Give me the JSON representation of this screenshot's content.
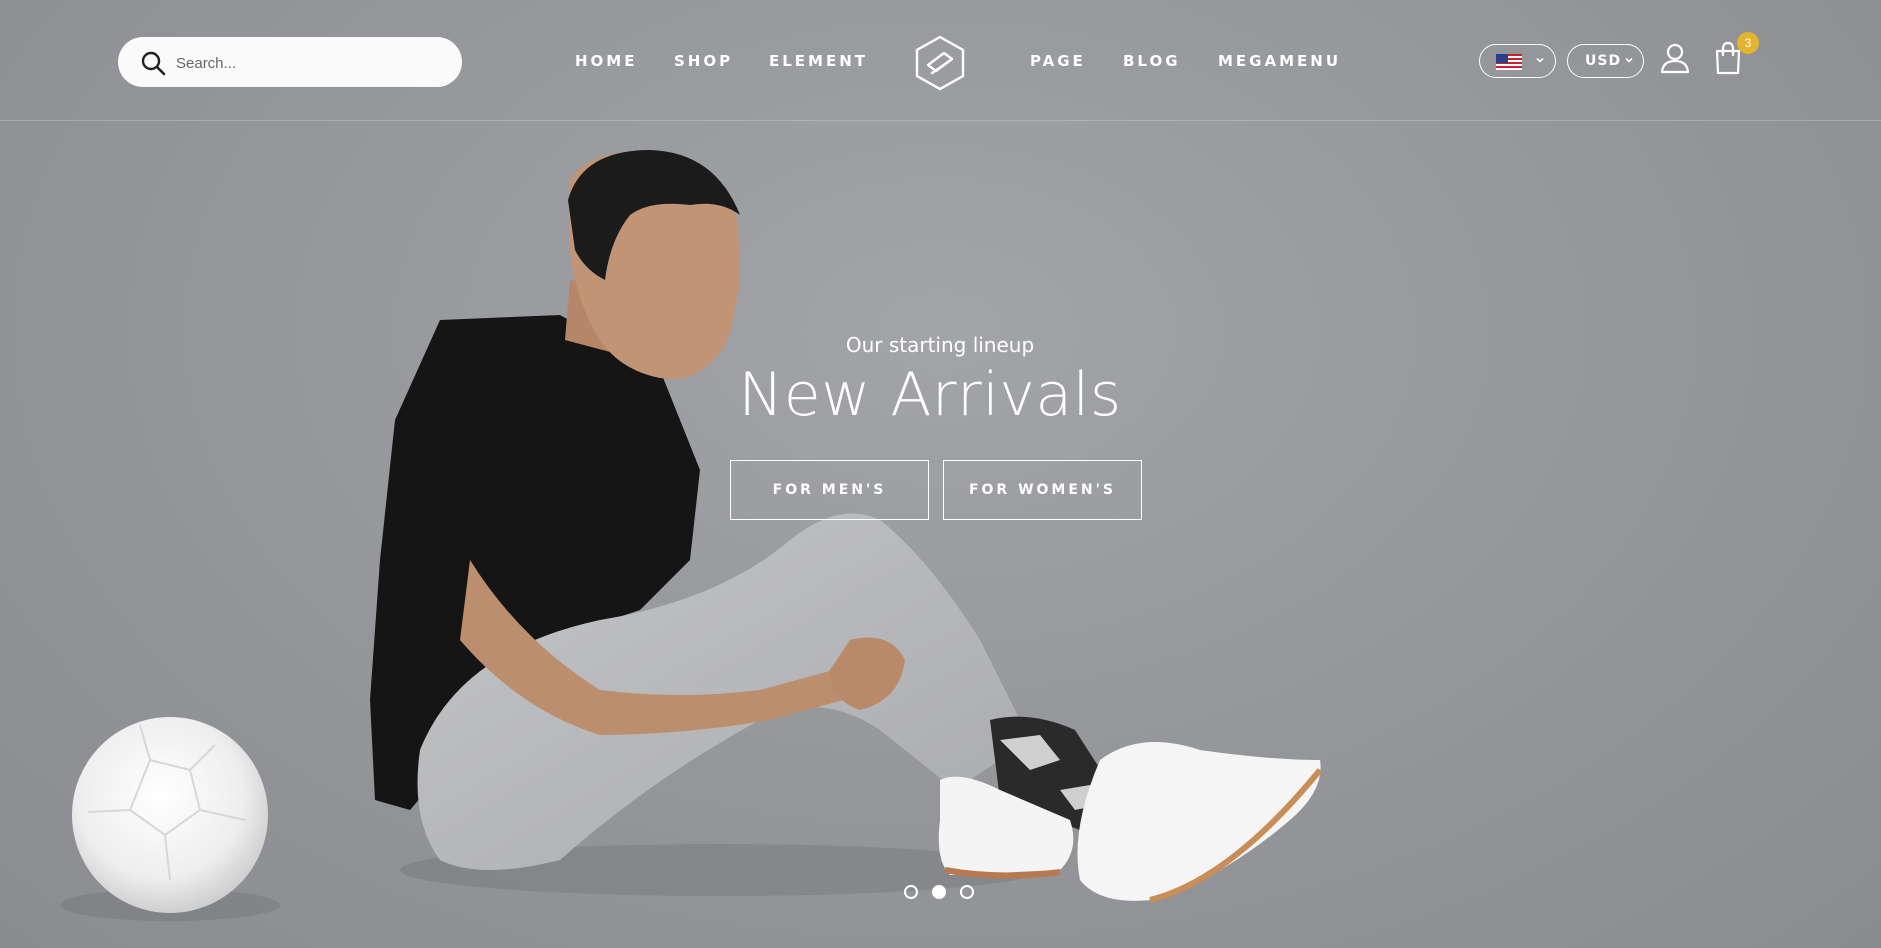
{
  "search": {
    "placeholder": "Search..."
  },
  "nav": {
    "items": [
      "HOME",
      "SHOP",
      "ELEMENT",
      "PAGE",
      "BLOG",
      "MEGAMENU"
    ]
  },
  "header": {
    "language": {
      "flag": "us-flag-icon"
    },
    "currency": {
      "label": "USD"
    },
    "cart": {
      "count": "3"
    }
  },
  "hero": {
    "subtitle": "Our starting lineup",
    "title": "New Arrivals",
    "buttons": [
      "FOR MEN'S",
      "FOR WOMEN'S"
    ],
    "slider": {
      "total": 3,
      "active": 2
    }
  },
  "colors": {
    "background": "#95979b",
    "badge": "#e3b52e",
    "text": "#ffffff"
  }
}
